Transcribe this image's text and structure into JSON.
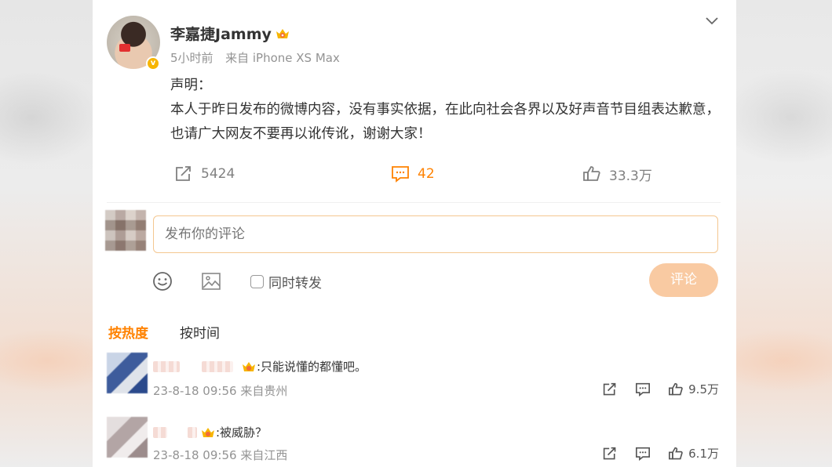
{
  "post": {
    "username": "李嘉捷Jammy",
    "time": "5小时前",
    "source": "来自 iPhone XS Max",
    "body_line1": "声明：",
    "body_line2": "本人于昨日发布的微博内容，没有事实依据，在此向社会各界以及好声音节目组表达歉意，也请广大网友不要再以讹传讹，谢谢大家！",
    "reposts": "5424",
    "comments": "42",
    "likes": "33.3万"
  },
  "composer": {
    "placeholder": "发布你的评论",
    "repost_label": "同时转发",
    "submit_label": "评论"
  },
  "sort": {
    "hot": "按热度",
    "time": "按时间"
  },
  "comments": [
    {
      "text": ":只能说懂的都懂吧。",
      "date": "23-8-18 09:56",
      "location": "来自贵州",
      "likes": "9.5万"
    },
    {
      "text": ":被威胁？",
      "date": "23-8-18 09:56",
      "location": "来自江西",
      "likes": "6.1万"
    }
  ],
  "colors": {
    "accent": "#ff8200",
    "button_disabled": "#f9caa2",
    "input_border": "#f4c790",
    "meta_text": "#939393"
  }
}
